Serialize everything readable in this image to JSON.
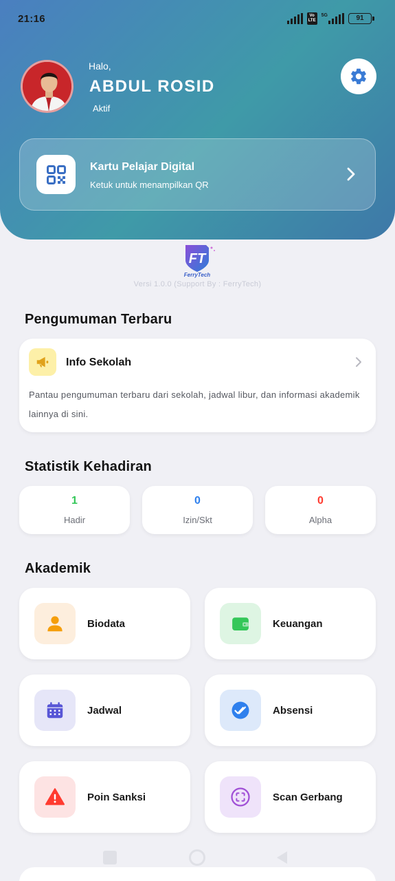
{
  "status_bar": {
    "time": "21:16",
    "battery": "91",
    "net_1": "Vo LTE",
    "net_2": "5G"
  },
  "profile": {
    "greeting": "Halo,",
    "name": "ABDUL ROSID",
    "status": "Aktif"
  },
  "qr_card": {
    "title": "Kartu Pelajar Digital",
    "subtitle": "Ketuk untuk menampilkan QR"
  },
  "brand": {
    "logo_text": "FerryTech",
    "version": "Versi 1.0.0 (Support By : FerryTech)"
  },
  "announcements": {
    "section_title": "Pengumuman Terbaru",
    "card_title": "Info Sekolah",
    "description": "Pantau pengumuman terbaru dari sekolah, jadwal libur, dan informasi akademik lainnya di sini."
  },
  "attendance": {
    "section_title": "Statistik Kehadiran",
    "stats": [
      {
        "value": "1",
        "label": "Hadir",
        "color": "#34c759"
      },
      {
        "value": "0",
        "label": "Izin/Skt",
        "color": "#2f80ed"
      },
      {
        "value": "0",
        "label": "Alpha",
        "color": "#ff3b30"
      }
    ]
  },
  "academic": {
    "section_title": "Akademik",
    "items": [
      {
        "label": "Biodata",
        "icon": "person-icon",
        "bg": "#fdeedd",
        "color": "#f59e0b"
      },
      {
        "label": "Keuangan",
        "icon": "wallet-icon",
        "bg": "#def5e3",
        "color": "#34c759"
      },
      {
        "label": "Jadwal",
        "icon": "calendar-icon",
        "bg": "#e6e6f8",
        "color": "#5856d6"
      },
      {
        "label": "Absensi",
        "icon": "check-badge-icon",
        "bg": "#dde9fa",
        "color": "#2f80ed"
      },
      {
        "label": "Poin Sanksi",
        "icon": "warning-icon",
        "bg": "#fde3e3",
        "color": "#ff3b30"
      },
      {
        "label": "Scan Gerbang",
        "icon": "scan-icon",
        "bg": "#efe3fa",
        "color": "#a04fd6"
      }
    ]
  },
  "colors": {
    "header_start": "#4a7fc0",
    "header_end": "#3e78a8",
    "settings_icon": "#3a7bd5",
    "qr_icon": "#3a6fc4"
  }
}
